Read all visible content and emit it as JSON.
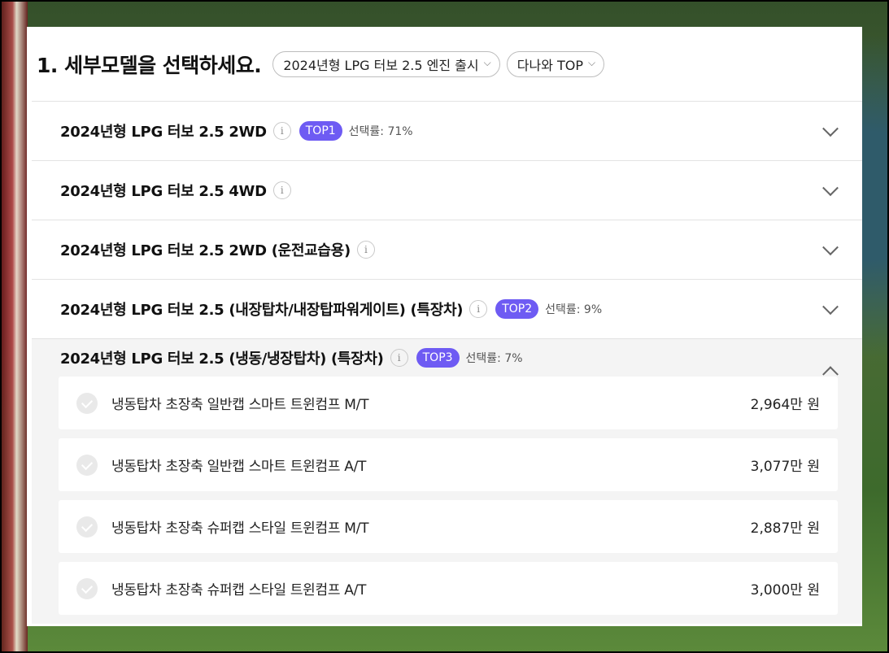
{
  "header": {
    "title": "1. 세부모델을 선택하세요.",
    "filter_model": "2024년형 LPG 터보 2.5 엔진 출시",
    "filter_sort": "다나와 TOP"
  },
  "models": [
    {
      "name": "2024년형 LPG 터보 2.5 2WD",
      "badge": "TOP1",
      "rate": "선택률: 71%"
    },
    {
      "name": "2024년형 LPG 터보 2.5 4WD"
    },
    {
      "name": "2024년형 LPG 터보 2.5 2WD (운전교습용)"
    },
    {
      "name": "2024년형 LPG 터보 2.5 (내장탑차/내장탑파워게이트) (특장차)",
      "badge": "TOP2",
      "rate": "선택률: 9%"
    },
    {
      "name": "2024년형 LPG 터보 2.5 (냉동/냉장탑차) (특장차)",
      "badge": "TOP3",
      "rate": "선택률: 7%",
      "options": [
        {
          "label": "냉동탑차 초장축 일반캡 스마트 트윈컴프 M/T",
          "price": "2,964만 원"
        },
        {
          "label": "냉동탑차 초장축 일반캡 스마트 트윈컴프 A/T",
          "price": "3,077만 원"
        },
        {
          "label": "냉동탑차 초장축 슈퍼캡 스타일 트윈컴프 M/T",
          "price": "2,887만 원"
        },
        {
          "label": "냉동탑차 초장축 슈퍼캡 스타일 트윈컴프 A/T",
          "price": "3,000만 원"
        }
      ]
    }
  ],
  "icons": {
    "info": "info-icon",
    "expand": "chevron-down-icon",
    "collapse": "chevron-up-icon",
    "check": "check-icon"
  },
  "colors": {
    "badge": "#6e5bf3"
  }
}
